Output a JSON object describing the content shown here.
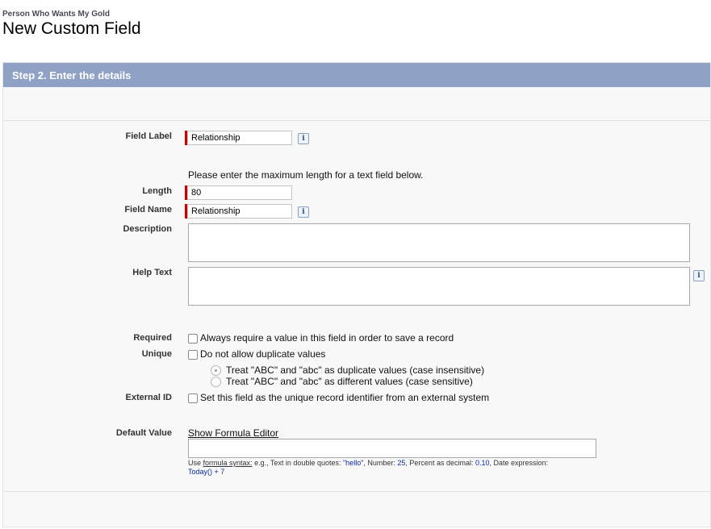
{
  "header": {
    "entity_name": "Person Who Wants My Gold",
    "title": "New Custom Field"
  },
  "panel": {
    "step_title": "Step 2. Enter the details"
  },
  "form": {
    "field_label": {
      "label": "Field Label",
      "value": "Relationship"
    },
    "length_note": "Please enter the maximum length for a text field below.",
    "length": {
      "label": "Length",
      "value": "80"
    },
    "field_name": {
      "label": "Field Name",
      "value": "Relationship"
    },
    "description": {
      "label": "Description",
      "value": ""
    },
    "help_text": {
      "label": "Help Text",
      "value": ""
    },
    "required": {
      "label": "Required",
      "text": "Always require a value in this field in order to save a record",
      "checked": false
    },
    "unique": {
      "label": "Unique",
      "text": "Do not allow duplicate values",
      "checked": false,
      "options": [
        {
          "text": "Treat \"ABC\" and \"abc\" as duplicate values (case insensitive)",
          "selected": true
        },
        {
          "text": "Treat \"ABC\" and \"abc\" as different values (case sensitive)",
          "selected": false
        }
      ]
    },
    "external_id": {
      "label": "External ID",
      "text": "Set this field as the unique record identifier from an external system",
      "checked": false
    },
    "default_value": {
      "label": "Default Value",
      "link": "Show Formula Editor",
      "value": "",
      "hint": {
        "use": "Use",
        "syntax_link": "formula syntax:",
        "intro": " e.g., Text in double quotes: ",
        "ex_text": "\"hello\"",
        "number_label": ", Number: ",
        "ex_number": "25",
        "percent_label": ", Percent as decimal: ",
        "ex_percent": "0.10",
        "date_label": ", Date expression:",
        "ex_date": "Today() + 7"
      }
    }
  },
  "colors": {
    "header_bar": "#8fa1c4",
    "required_marker": "#cc0000",
    "example_blue": "#0a2aa8"
  },
  "icons": {
    "info": "info-icon"
  }
}
